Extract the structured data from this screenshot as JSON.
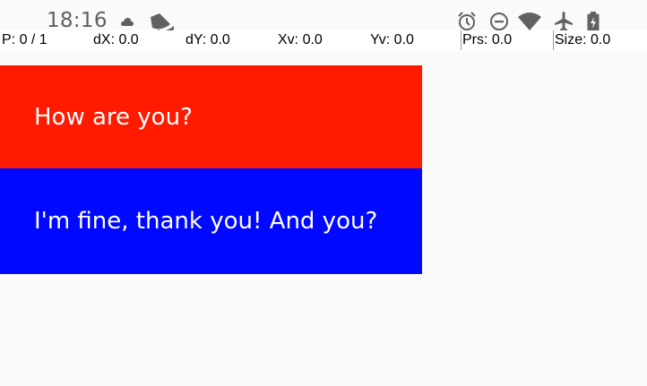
{
  "status_bar": {
    "time": "18:16",
    "notification_icons": [
      "cloud-icon",
      "app-notification-icon"
    ],
    "system_icons": [
      "alarm-icon",
      "do-not-disturb-icon",
      "wifi-icon",
      "airplane-mode-icon",
      "battery-charging-icon"
    ]
  },
  "pointer_location": {
    "pointers": "P: 0 / 1",
    "dx": "dX: 0.0",
    "dy": "dY: 0.0",
    "xv": "Xv: 0.0",
    "yv": "Yv: 0.0",
    "pressure": "Prs: 0.0",
    "size": "Size: 0.0"
  },
  "messages": [
    {
      "text": "How are you?",
      "color": "#ff1a00"
    },
    {
      "text": "I'm fine, thank you! And you?",
      "color": "#0008ff"
    }
  ]
}
